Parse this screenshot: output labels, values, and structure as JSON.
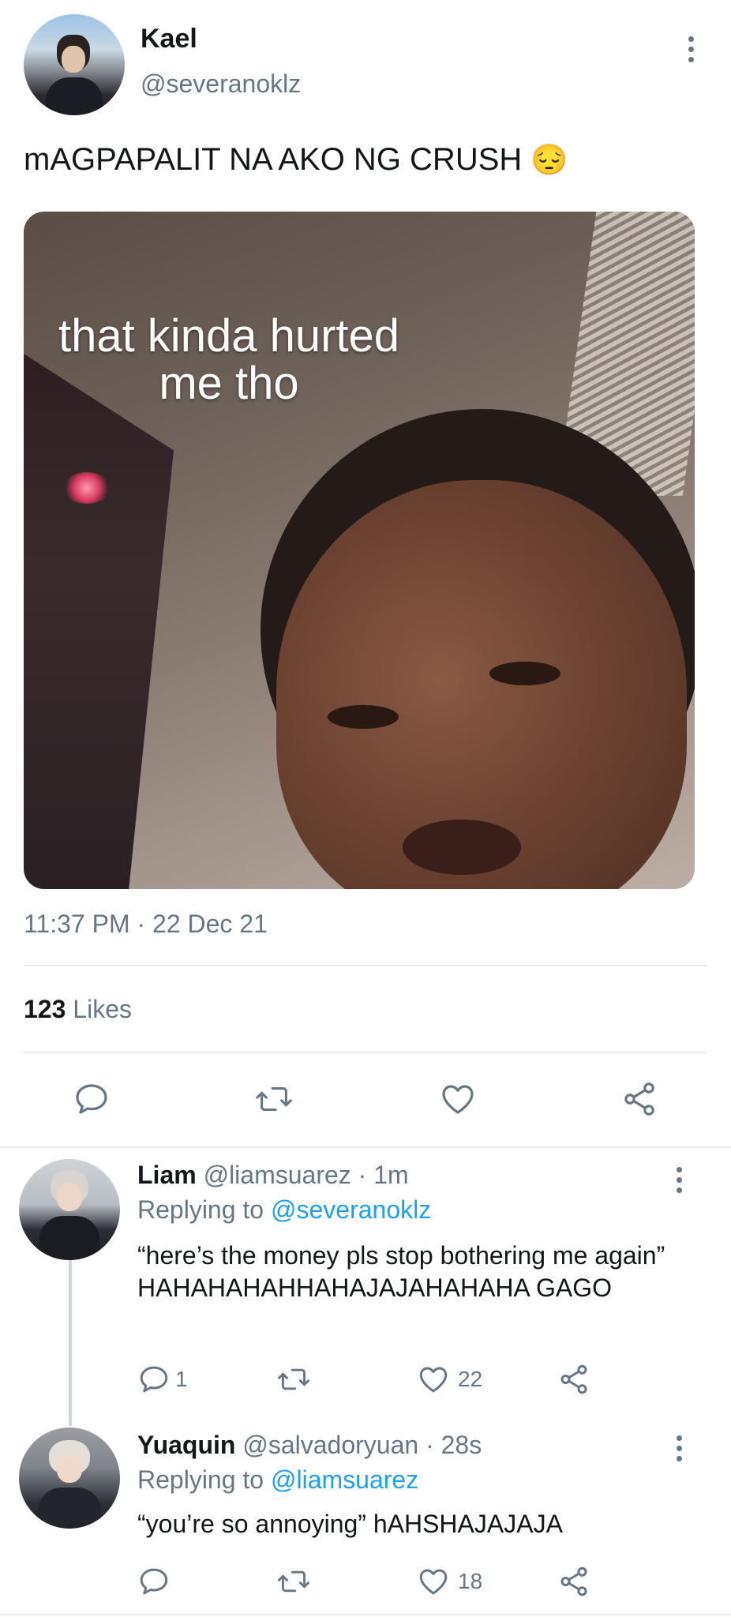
{
  "tweet": {
    "author_name": "Kael",
    "author_handle": "@severanoklz",
    "text": "mAGPAPALIT NA AKO NG CRUSH",
    "emoji": "😔",
    "image_caption_line1": "that kinda hurted",
    "image_caption_line2": "me tho",
    "time": "11:37 PM",
    "separator": "·",
    "date": "22 Dec 21",
    "likes_count": "123",
    "likes_label": "Likes"
  },
  "replies": [
    {
      "name": "Liam",
      "handle": "@liamsuarez",
      "dot": "·",
      "time": "1m",
      "replying_prefix": "Replying to",
      "replying_to": "@severanoklz",
      "text": "“here’s the money pls stop bothering me again” HAHAHAHAHHAHAJAJAHAHAHA GAGO",
      "reply_count": "1",
      "like_count": "22"
    },
    {
      "name": "Yuaquin",
      "handle": "@salvadoryuan",
      "dot": "·",
      "time": "28s",
      "replying_prefix": "Replying to",
      "replying_to": "@liamsuarez",
      "text": "“you’re so annoying” hAHSHAJAJAJA",
      "reply_count": "",
      "like_count": "18"
    }
  ],
  "icons": {
    "reply": "reply-icon",
    "retweet": "retweet-icon",
    "like": "heart-icon",
    "share": "share-icon",
    "more": "more-vertical-icon"
  },
  "colors": {
    "link": "#1da1f2",
    "muted": "#657786",
    "text": "#14171a",
    "divider": "#e6ecf0"
  }
}
